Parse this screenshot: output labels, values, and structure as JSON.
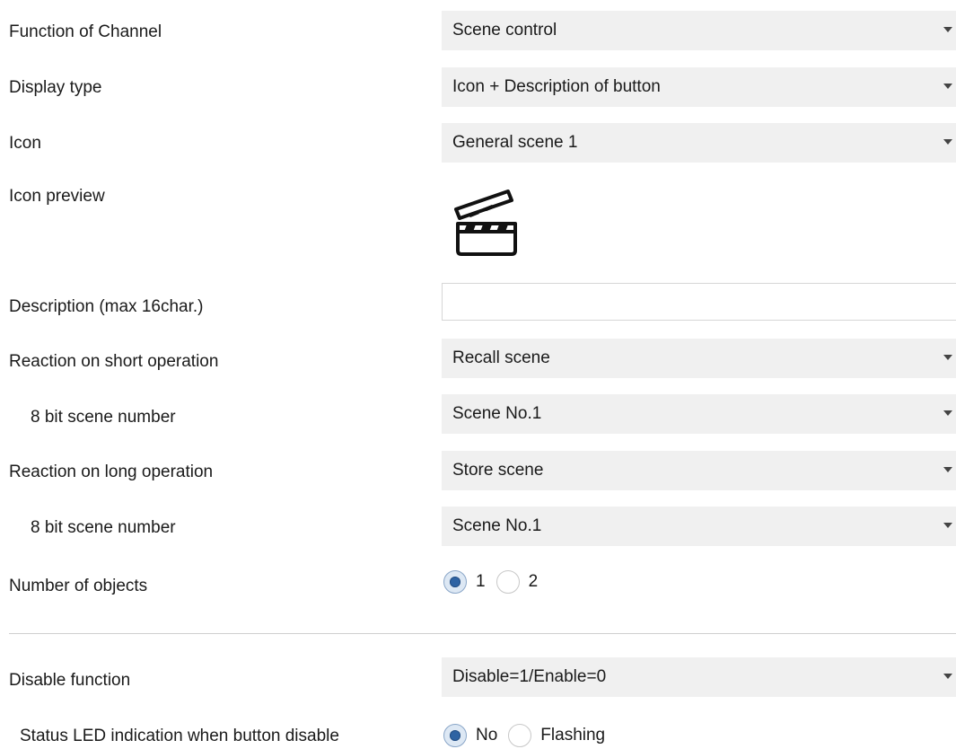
{
  "function_of_channel": {
    "label": "Function of Channel",
    "value": "Scene control"
  },
  "display_type": {
    "label": "Display type",
    "value": "Icon + Description of button"
  },
  "icon": {
    "label": "Icon",
    "value": "General scene 1"
  },
  "icon_preview": {
    "label": "Icon preview",
    "icon_name": "clapperboard-icon"
  },
  "description": {
    "label": "Description (max 16char.)",
    "value": ""
  },
  "short_operation": {
    "label": "Reaction on short operation",
    "value": "Recall scene"
  },
  "short_scene_number": {
    "label": "8 bit scene number",
    "value": "Scene No.1"
  },
  "long_operation": {
    "label": "Reaction on long operation",
    "value": "Store scene"
  },
  "long_scene_number": {
    "label": "8 bit scene number",
    "value": "Scene No.1"
  },
  "number_of_objects": {
    "label": "Number of objects",
    "options": [
      "1",
      "2"
    ],
    "selected": "1"
  },
  "disable_function": {
    "label": "Disable function",
    "value": "Disable=1/Enable=0"
  },
  "status_led": {
    "label": "Status LED indication when button disable",
    "options": [
      "No",
      "Flashing"
    ],
    "selected": "No"
  },
  "colors": {
    "dropdown_bg": "#f0f0f0",
    "radio_checked": "#2e63a3",
    "divider": "#cfcfcf"
  }
}
